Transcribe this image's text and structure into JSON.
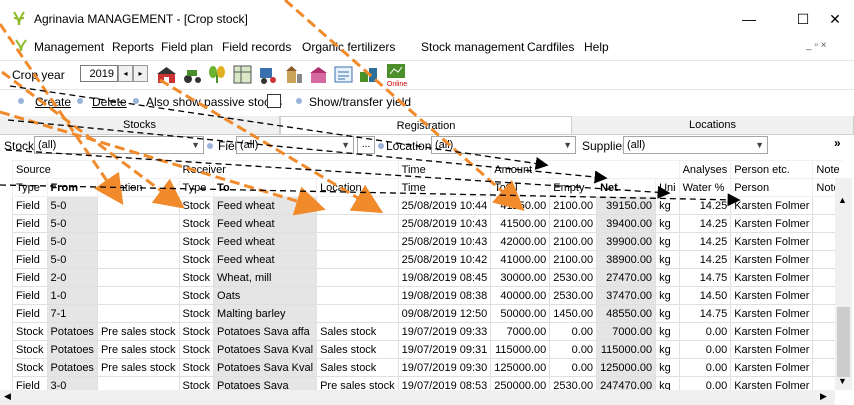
{
  "window": {
    "title": "Agrinavia MANAGEMENT - [Crop stock]",
    "minimize": "—",
    "maximize": "☐",
    "close": "✕",
    "mdi_controls": "_ ▫ ×"
  },
  "menu": [
    "Management",
    "Reports",
    "Field plan",
    "Field records",
    "Organic fertilizers",
    "Stock management",
    "Cardfiles",
    "Help"
  ],
  "toolbar": {
    "crop_year_label": "Crop year",
    "crop_year": "2019",
    "spin_left": "◂",
    "spin_right": "▸",
    "online_label": "Online"
  },
  "actions": {
    "create": "Create",
    "delete": "Delete",
    "show_passive": "Also show passive stocks",
    "show_transfer": "Show/transfer yield"
  },
  "tabs": [
    "Stocks",
    "Registration",
    "Locations"
  ],
  "filters": {
    "stock_label": "Stock",
    "stock_value": "(all)",
    "field_label": "Field",
    "field_value": "(all)",
    "location_label": "Location",
    "location_value": "(all)",
    "supplier_label": "Supplier",
    "supplier_value": "(all)",
    "ellipsis": "...",
    "more": "»"
  },
  "grid": {
    "group_headers": [
      "Source",
      "Receiver",
      "Time",
      "Amount",
      "Analyses",
      "Person etc.",
      "Note"
    ],
    "columns": [
      "Type",
      "From",
      "Location",
      "Type",
      "To",
      "Location",
      "Time",
      "Total",
      "Empty",
      "Net",
      "Uni",
      "Water %",
      "Person",
      "Note"
    ],
    "rows": [
      [
        "Field",
        "5-0",
        "",
        "Stock",
        "Feed wheat",
        "",
        "25/08/2019 10:44",
        "41250.00",
        "2100.00",
        "39150.00",
        "kg",
        "14.25",
        "Karsten Folmer",
        ""
      ],
      [
        "Field",
        "5-0",
        "",
        "Stock",
        "Feed wheat",
        "",
        "25/08/2019 10:43",
        "41500.00",
        "2100.00",
        "39400.00",
        "kg",
        "14.25",
        "Karsten Folmer",
        ""
      ],
      [
        "Field",
        "5-0",
        "",
        "Stock",
        "Feed wheat",
        "",
        "25/08/2019 10:43",
        "42000.00",
        "2100.00",
        "39900.00",
        "kg",
        "14.25",
        "Karsten Folmer",
        ""
      ],
      [
        "Field",
        "5-0",
        "",
        "Stock",
        "Feed wheat",
        "",
        "25/08/2019 10:42",
        "41000.00",
        "2100.00",
        "38900.00",
        "kg",
        "14.25",
        "Karsten Folmer",
        ""
      ],
      [
        "Field",
        "2-0",
        "",
        "Stock",
        "Wheat, mill",
        "",
        "19/08/2019 08:45",
        "30000.00",
        "2530.00",
        "27470.00",
        "kg",
        "14.75",
        "Karsten Folmer",
        ""
      ],
      [
        "Field",
        "1-0",
        "",
        "Stock",
        "Oats",
        "",
        "19/08/2019 08:38",
        "40000.00",
        "2530.00",
        "37470.00",
        "kg",
        "14.50",
        "Karsten Folmer",
        ""
      ],
      [
        "Field",
        "7-1",
        "",
        "Stock",
        "Malting barley",
        "",
        "09/08/2019 12:50",
        "50000.00",
        "1450.00",
        "48550.00",
        "kg",
        "14.75",
        "Karsten Folmer",
        ""
      ],
      [
        "Stock",
        "Potatoes",
        "Pre sales stock",
        "Stock",
        "Potatoes Sava affa",
        "Sales stock",
        "19/07/2019 09:33",
        "7000.00",
        "0.00",
        "7000.00",
        "kg",
        "0.00",
        "Karsten Folmer",
        ""
      ],
      [
        "Stock",
        "Potatoes",
        "Pre sales stock",
        "Stock",
        "Potatoes Sava Kval",
        "Sales stock",
        "19/07/2019 09:31",
        "115000.00",
        "0.00",
        "115000.00",
        "kg",
        "0.00",
        "Karsten Folmer",
        ""
      ],
      [
        "Stock",
        "Potatoes",
        "Pre sales stock",
        "Stock",
        "Potatoes Sava Kval",
        "Sales stock",
        "19/07/2019 09:30",
        "125000.00",
        "0.00",
        "125000.00",
        "kg",
        "0.00",
        "Karsten Folmer",
        ""
      ],
      [
        "Field",
        "3-0",
        "",
        "Stock",
        "Potatoes Sava",
        "Pre sales stock",
        "19/07/2019 08:53",
        "250000.00",
        "2530.00",
        "247470.00",
        "kg",
        "0.00",
        "Karsten Folmer",
        ""
      ]
    ]
  },
  "colors": {
    "shaded_cell": "#e5e5e5",
    "orange_arrow": "#f08a2a",
    "black_arrow": "#000000"
  }
}
